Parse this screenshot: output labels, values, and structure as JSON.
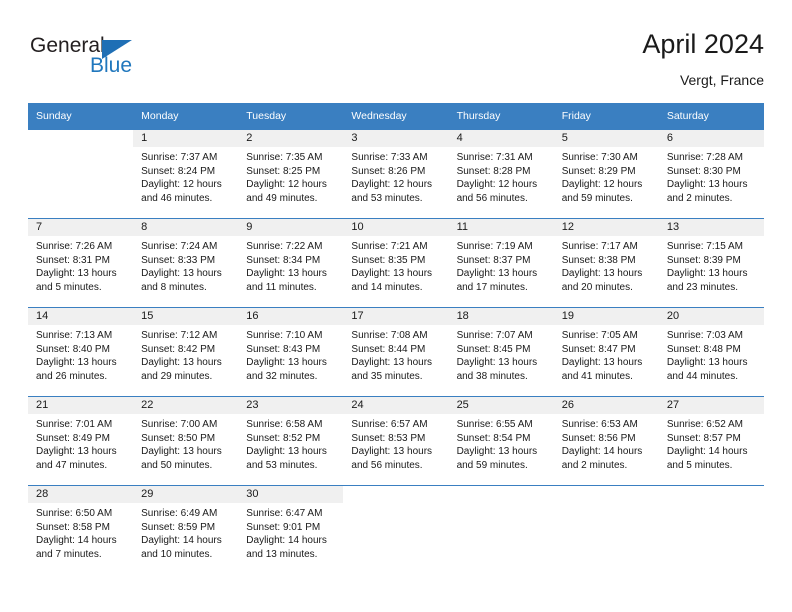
{
  "logo": {
    "word1": "General",
    "word2": "Blue"
  },
  "header": {
    "title": "April 2024",
    "subtitle": "Vergt, France"
  },
  "weekday_headers": [
    "Sunday",
    "Monday",
    "Tuesday",
    "Wednesday",
    "Thursday",
    "Friday",
    "Saturday"
  ],
  "colors": {
    "header_blue": "#3a7fc1",
    "logo_blue": "#2077bd",
    "daynum_bg": "#f0f0f0",
    "text": "#1a1a1a"
  },
  "weeks": [
    [
      {
        "empty": true,
        "day": ""
      },
      {
        "day": "1",
        "sunrise": "Sunrise: 7:37 AM",
        "sunset": "Sunset: 8:24 PM",
        "daylight_1": "Daylight: 12 hours",
        "daylight_2": "and 46 minutes."
      },
      {
        "day": "2",
        "sunrise": "Sunrise: 7:35 AM",
        "sunset": "Sunset: 8:25 PM",
        "daylight_1": "Daylight: 12 hours",
        "daylight_2": "and 49 minutes."
      },
      {
        "day": "3",
        "sunrise": "Sunrise: 7:33 AM",
        "sunset": "Sunset: 8:26 PM",
        "daylight_1": "Daylight: 12 hours",
        "daylight_2": "and 53 minutes."
      },
      {
        "day": "4",
        "sunrise": "Sunrise: 7:31 AM",
        "sunset": "Sunset: 8:28 PM",
        "daylight_1": "Daylight: 12 hours",
        "daylight_2": "and 56 minutes."
      },
      {
        "day": "5",
        "sunrise": "Sunrise: 7:30 AM",
        "sunset": "Sunset: 8:29 PM",
        "daylight_1": "Daylight: 12 hours",
        "daylight_2": "and 59 minutes."
      },
      {
        "day": "6",
        "sunrise": "Sunrise: 7:28 AM",
        "sunset": "Sunset: 8:30 PM",
        "daylight_1": "Daylight: 13 hours",
        "daylight_2": "and 2 minutes."
      }
    ],
    [
      {
        "day": "7",
        "sunrise": "Sunrise: 7:26 AM",
        "sunset": "Sunset: 8:31 PM",
        "daylight_1": "Daylight: 13 hours",
        "daylight_2": "and 5 minutes."
      },
      {
        "day": "8",
        "sunrise": "Sunrise: 7:24 AM",
        "sunset": "Sunset: 8:33 PM",
        "daylight_1": "Daylight: 13 hours",
        "daylight_2": "and 8 minutes."
      },
      {
        "day": "9",
        "sunrise": "Sunrise: 7:22 AM",
        "sunset": "Sunset: 8:34 PM",
        "daylight_1": "Daylight: 13 hours",
        "daylight_2": "and 11 minutes."
      },
      {
        "day": "10",
        "sunrise": "Sunrise: 7:21 AM",
        "sunset": "Sunset: 8:35 PM",
        "daylight_1": "Daylight: 13 hours",
        "daylight_2": "and 14 minutes."
      },
      {
        "day": "11",
        "sunrise": "Sunrise: 7:19 AM",
        "sunset": "Sunset: 8:37 PM",
        "daylight_1": "Daylight: 13 hours",
        "daylight_2": "and 17 minutes."
      },
      {
        "day": "12",
        "sunrise": "Sunrise: 7:17 AM",
        "sunset": "Sunset: 8:38 PM",
        "daylight_1": "Daylight: 13 hours",
        "daylight_2": "and 20 minutes."
      },
      {
        "day": "13",
        "sunrise": "Sunrise: 7:15 AM",
        "sunset": "Sunset: 8:39 PM",
        "daylight_1": "Daylight: 13 hours",
        "daylight_2": "and 23 minutes."
      }
    ],
    [
      {
        "day": "14",
        "sunrise": "Sunrise: 7:13 AM",
        "sunset": "Sunset: 8:40 PM",
        "daylight_1": "Daylight: 13 hours",
        "daylight_2": "and 26 minutes."
      },
      {
        "day": "15",
        "sunrise": "Sunrise: 7:12 AM",
        "sunset": "Sunset: 8:42 PM",
        "daylight_1": "Daylight: 13 hours",
        "daylight_2": "and 29 minutes."
      },
      {
        "day": "16",
        "sunrise": "Sunrise: 7:10 AM",
        "sunset": "Sunset: 8:43 PM",
        "daylight_1": "Daylight: 13 hours",
        "daylight_2": "and 32 minutes."
      },
      {
        "day": "17",
        "sunrise": "Sunrise: 7:08 AM",
        "sunset": "Sunset: 8:44 PM",
        "daylight_1": "Daylight: 13 hours",
        "daylight_2": "and 35 minutes."
      },
      {
        "day": "18",
        "sunrise": "Sunrise: 7:07 AM",
        "sunset": "Sunset: 8:45 PM",
        "daylight_1": "Daylight: 13 hours",
        "daylight_2": "and 38 minutes."
      },
      {
        "day": "19",
        "sunrise": "Sunrise: 7:05 AM",
        "sunset": "Sunset: 8:47 PM",
        "daylight_1": "Daylight: 13 hours",
        "daylight_2": "and 41 minutes."
      },
      {
        "day": "20",
        "sunrise": "Sunrise: 7:03 AM",
        "sunset": "Sunset: 8:48 PM",
        "daylight_1": "Daylight: 13 hours",
        "daylight_2": "and 44 minutes."
      }
    ],
    [
      {
        "day": "21",
        "sunrise": "Sunrise: 7:01 AM",
        "sunset": "Sunset: 8:49 PM",
        "daylight_1": "Daylight: 13 hours",
        "daylight_2": "and 47 minutes."
      },
      {
        "day": "22",
        "sunrise": "Sunrise: 7:00 AM",
        "sunset": "Sunset: 8:50 PM",
        "daylight_1": "Daylight: 13 hours",
        "daylight_2": "and 50 minutes."
      },
      {
        "day": "23",
        "sunrise": "Sunrise: 6:58 AM",
        "sunset": "Sunset: 8:52 PM",
        "daylight_1": "Daylight: 13 hours",
        "daylight_2": "and 53 minutes."
      },
      {
        "day": "24",
        "sunrise": "Sunrise: 6:57 AM",
        "sunset": "Sunset: 8:53 PM",
        "daylight_1": "Daylight: 13 hours",
        "daylight_2": "and 56 minutes."
      },
      {
        "day": "25",
        "sunrise": "Sunrise: 6:55 AM",
        "sunset": "Sunset: 8:54 PM",
        "daylight_1": "Daylight: 13 hours",
        "daylight_2": "and 59 minutes."
      },
      {
        "day": "26",
        "sunrise": "Sunrise: 6:53 AM",
        "sunset": "Sunset: 8:56 PM",
        "daylight_1": "Daylight: 14 hours",
        "daylight_2": "and 2 minutes."
      },
      {
        "day": "27",
        "sunrise": "Sunrise: 6:52 AM",
        "sunset": "Sunset: 8:57 PM",
        "daylight_1": "Daylight: 14 hours",
        "daylight_2": "and 5 minutes."
      }
    ],
    [
      {
        "day": "28",
        "sunrise": "Sunrise: 6:50 AM",
        "sunset": "Sunset: 8:58 PM",
        "daylight_1": "Daylight: 14 hours",
        "daylight_2": "and 7 minutes."
      },
      {
        "day": "29",
        "sunrise": "Sunrise: 6:49 AM",
        "sunset": "Sunset: 8:59 PM",
        "daylight_1": "Daylight: 14 hours",
        "daylight_2": "and 10 minutes."
      },
      {
        "day": "30",
        "sunrise": "Sunrise: 6:47 AM",
        "sunset": "Sunset: 9:01 PM",
        "daylight_1": "Daylight: 14 hours",
        "daylight_2": "and 13 minutes."
      },
      {
        "empty": true,
        "day": ""
      },
      {
        "empty": true,
        "day": ""
      },
      {
        "empty": true,
        "day": ""
      },
      {
        "empty": true,
        "day": ""
      }
    ]
  ]
}
